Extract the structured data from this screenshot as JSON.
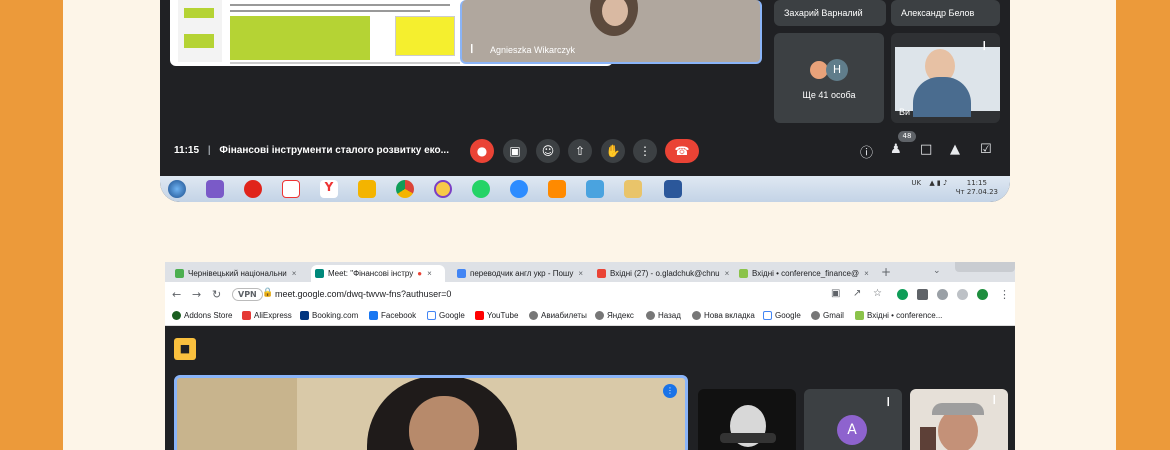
{
  "top_meeting": {
    "presenter_name": "Agnieszka Wikarczyk",
    "tile_names": [
      "Захарий Варналий",
      "Александр Белов"
    ],
    "more_count_label": "Ще 41 особа",
    "more_avatar_letter": "Н",
    "self_label": "Ви",
    "time": "11:15",
    "meeting_title": "Фінансові інструменти сталого розвитку еко...",
    "participants_count": "48",
    "taskbar": {
      "lang": "UK",
      "clock_time": "11:15",
      "clock_date": "Чт 27.04.23"
    },
    "colors": {
      "hangup": "#ea4335",
      "accent": "#8ab4f8"
    }
  },
  "bottom_browser": {
    "tabs": [
      {
        "label": "Чернівецький національни",
        "close": "×"
      },
      {
        "label": "Meet: \"Фінансові інстру",
        "close": "×"
      },
      {
        "label": "переводчик англ укр - Пошу",
        "close": "×"
      },
      {
        "label": "Вхідні (27) - o.gladchuk@chnu",
        "close": "×"
      },
      {
        "label": "Вхідні • conference_finance@",
        "close": "×"
      }
    ],
    "new_tab": "+",
    "vpn_label": "VPN",
    "url": "meet.google.com/dwq-twvw-fns?authuser=0",
    "bookmarks": [
      "Addons Store",
      "AliExpress",
      "Booking.com",
      "Facebook",
      "Google",
      "YouTube",
      "Авиабилеты",
      "Яндекс",
      "Назад",
      "Нова вкладка",
      "Google",
      "Gmail",
      "Вхідні • conference..."
    ],
    "participant_letter": "A"
  }
}
